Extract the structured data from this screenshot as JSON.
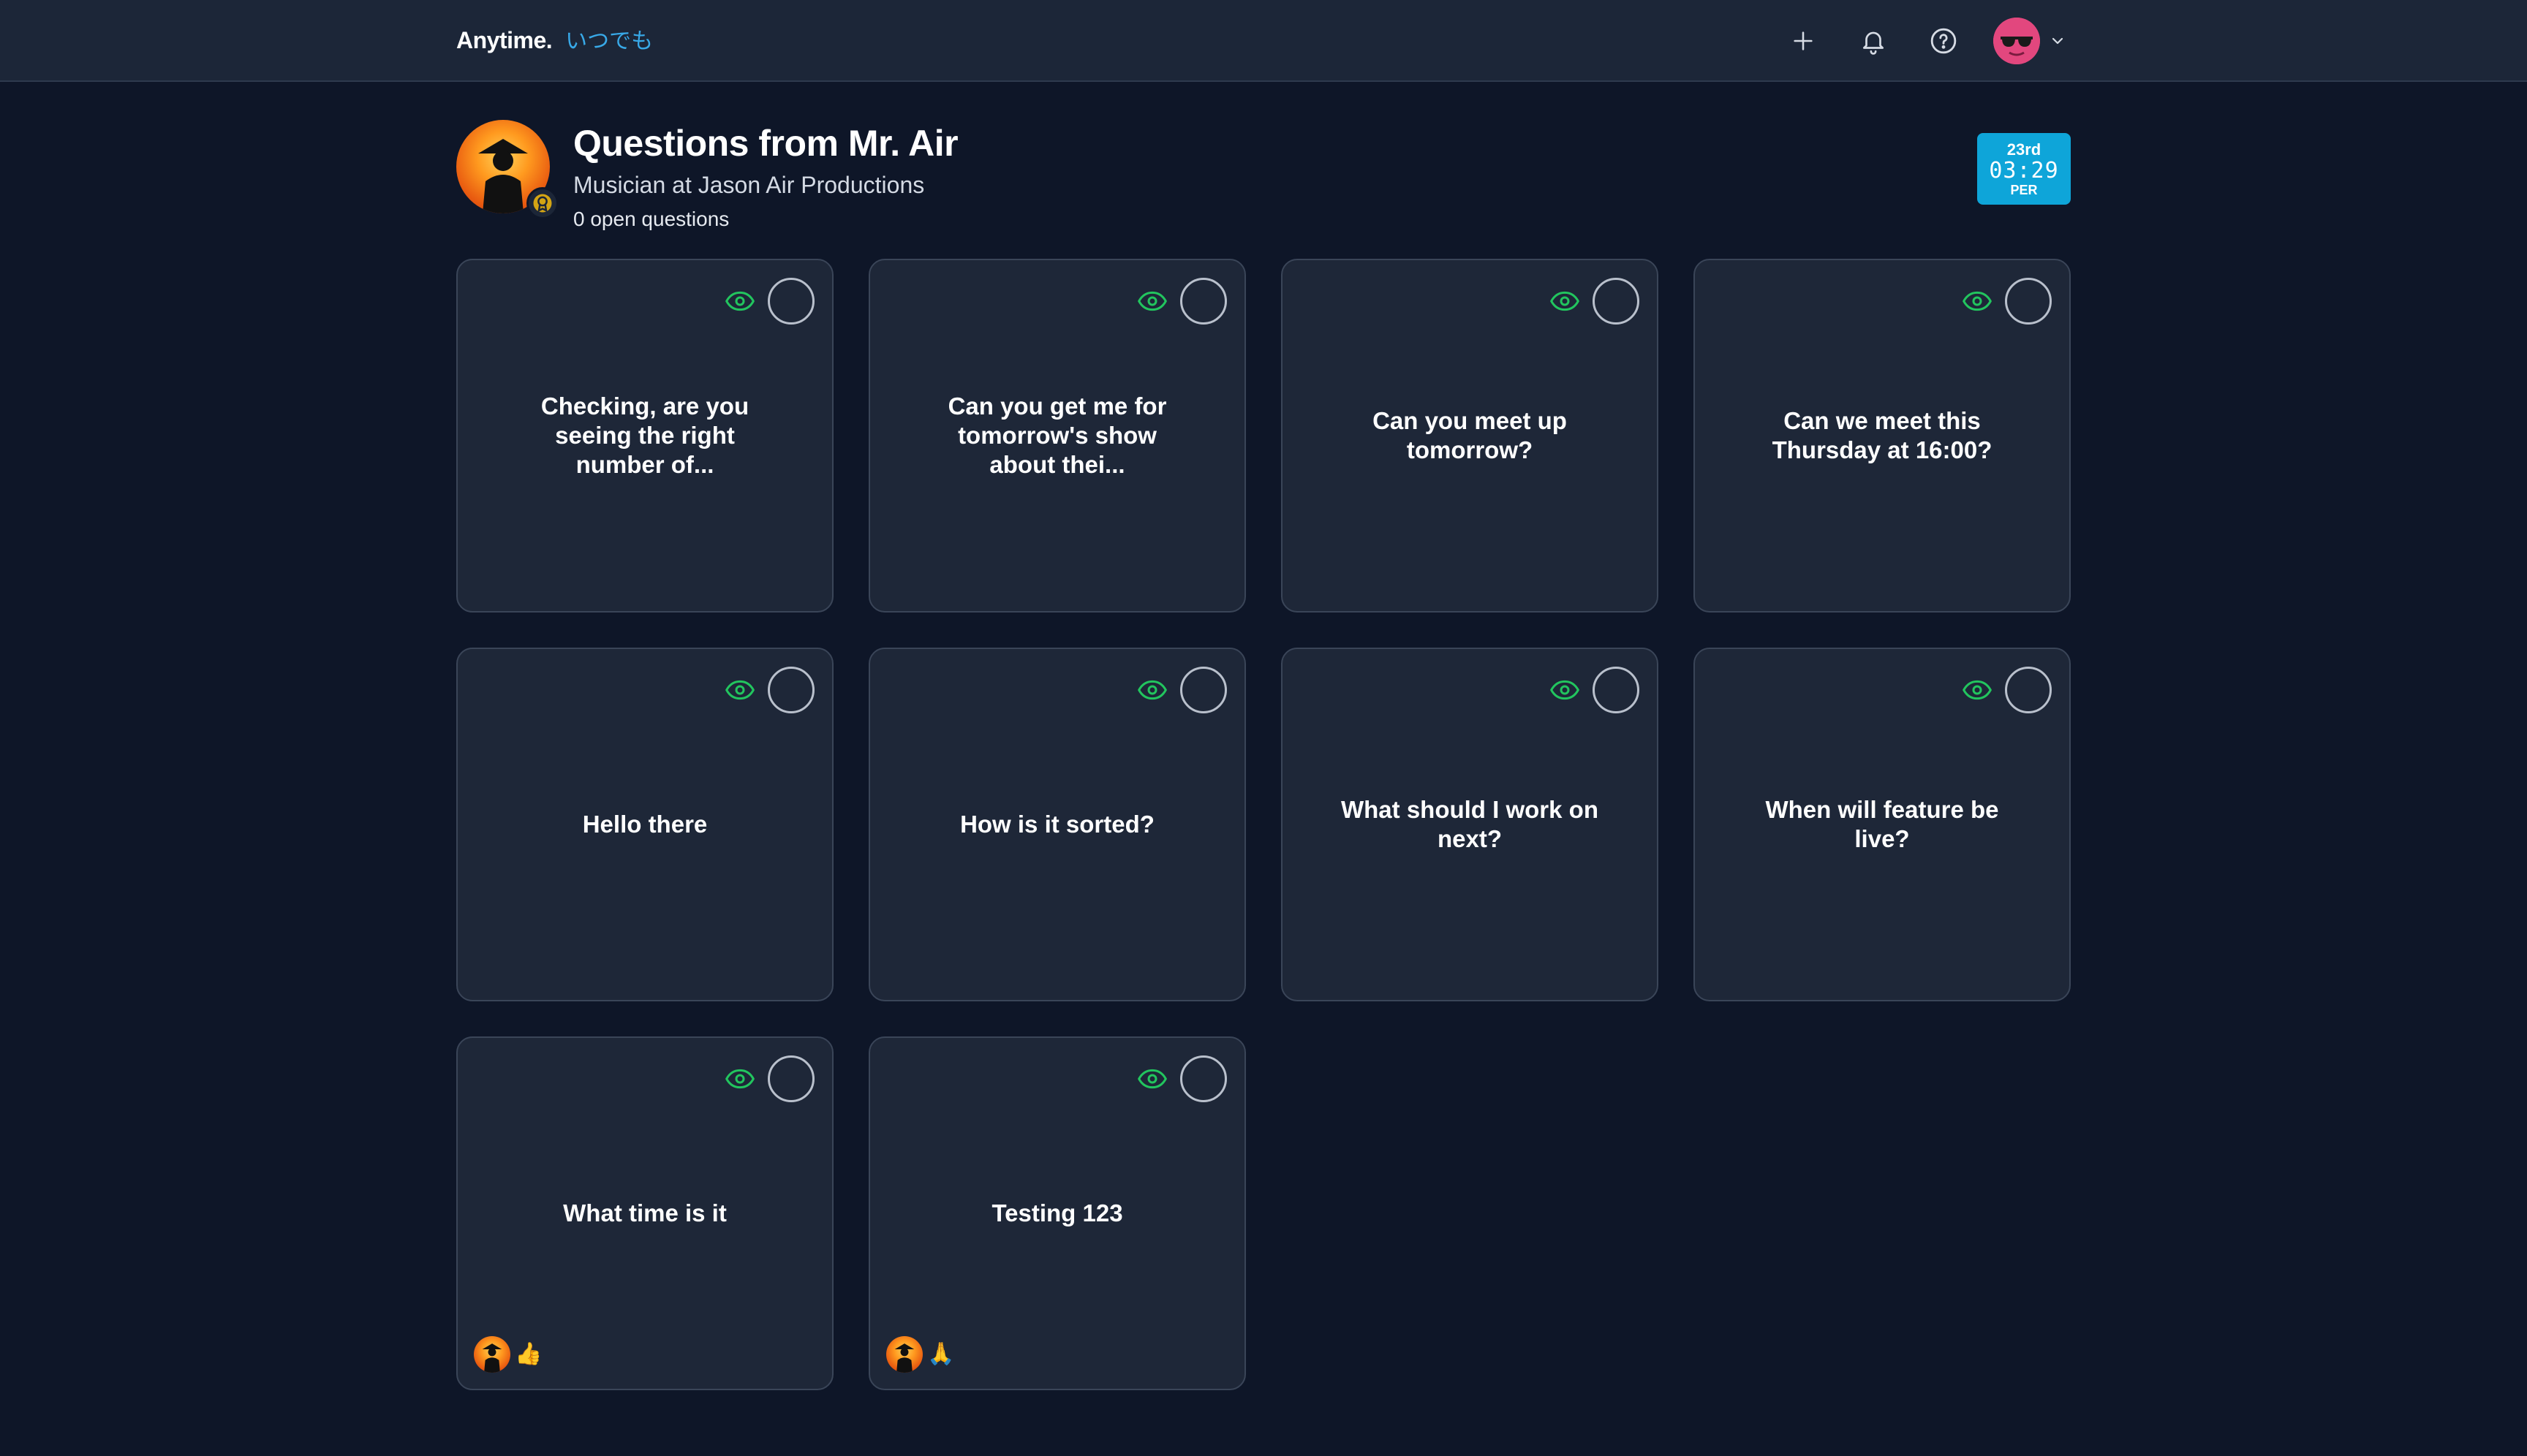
{
  "topbar": {
    "brand_name": "Anytime.",
    "brand_jp": "いつでも",
    "actions": [
      {
        "name": "add-button",
        "icon": "plus-icon"
      },
      {
        "name": "notifications-button",
        "icon": "bell-icon"
      },
      {
        "name": "help-button",
        "icon": "help-circle-icon"
      }
    ],
    "user_menu_icon": "chevron-down-icon",
    "avatar_color": "#e2477e"
  },
  "profile": {
    "title": "Questions from Mr. Air",
    "subtitle": "Musician at Jason Air Productions",
    "open_count": "0 open questions"
  },
  "date_badge": {
    "day": "23rd",
    "time": "03:29",
    "zone": "PER",
    "color": "#0ea5d9"
  },
  "colors": {
    "background": "#0e1628",
    "card": "#1e2738",
    "eye": "#22c55e",
    "accent": "#38a9e8"
  },
  "questions": [
    {
      "text": "Checking, are you seeing the right number of...",
      "reactions": []
    },
    {
      "text": "Can you get me for tomorrow's show about thei...",
      "reactions": []
    },
    {
      "text": "Can you meet up tomorrow?",
      "reactions": []
    },
    {
      "text": "Can we meet this Thursday at 16:00?",
      "reactions": []
    },
    {
      "text": "Hello there",
      "reactions": []
    },
    {
      "text": "How is it sorted?",
      "reactions": []
    },
    {
      "text": "What should I work on next?",
      "reactions": []
    },
    {
      "text": "When will feature be live?",
      "reactions": []
    },
    {
      "text": "What time is it",
      "reactions": [
        "👍"
      ]
    },
    {
      "text": "Testing 123",
      "reactions": [
        "🙏"
      ]
    }
  ]
}
